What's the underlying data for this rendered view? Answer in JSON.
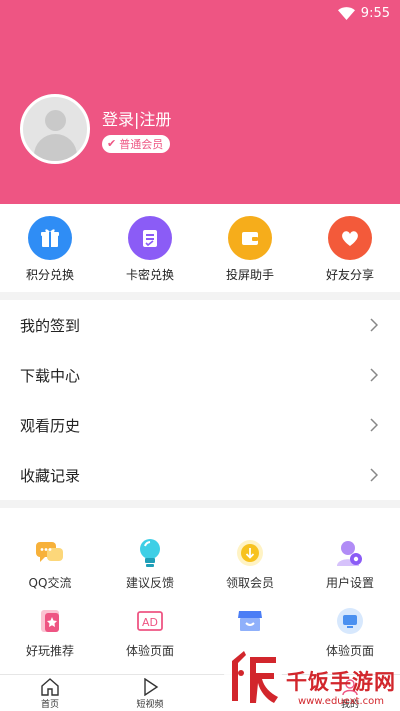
{
  "status_bar": {
    "time": "9:55"
  },
  "profile": {
    "login_text": "登录|注册",
    "membership_badge": "普通会员"
  },
  "quick_actions": [
    {
      "label": "积分兑换",
      "icon": "gift-icon",
      "color": "#2f8df5"
    },
    {
      "label": "卡密兑换",
      "icon": "card-icon",
      "color": "#8b5cf6"
    },
    {
      "label": "投屏助手",
      "icon": "wallet-icon",
      "color": "#f6ad1b"
    },
    {
      "label": "好友分享",
      "icon": "heart-icon",
      "color": "#f35a3a"
    }
  ],
  "menu": [
    {
      "label": "我的签到"
    },
    {
      "label": "下载中心"
    },
    {
      "label": "观看历史"
    },
    {
      "label": "收藏记录"
    }
  ],
  "services": [
    {
      "label": "QQ交流",
      "icon": "chat-bubbles-icon"
    },
    {
      "label": "建议反馈",
      "icon": "lightbulb-icon"
    },
    {
      "label": "领取会员",
      "icon": "coin-icon"
    },
    {
      "label": "用户设置",
      "icon": "user-settings-icon"
    }
  ],
  "services_row2": [
    {
      "label": "好玩推荐",
      "icon": "star-card-icon"
    },
    {
      "label": "体验页面",
      "icon": "ad-icon"
    },
    {
      "label": "",
      "icon": "shop-icon"
    },
    {
      "label": "体验页面",
      "icon": "monitor-icon"
    }
  ],
  "tabbar": [
    {
      "label": "首页",
      "icon": "home-icon"
    },
    {
      "label": "短视频",
      "icon": "play-icon"
    },
    {
      "label": "",
      "icon": ""
    },
    {
      "label": "我的",
      "icon": "user-icon"
    }
  ],
  "watermark": {
    "brand": "千饭手游网",
    "url": "www.eduext.com"
  },
  "colors": {
    "header_bg": "#ee5583",
    "accent": "#ee5583"
  }
}
